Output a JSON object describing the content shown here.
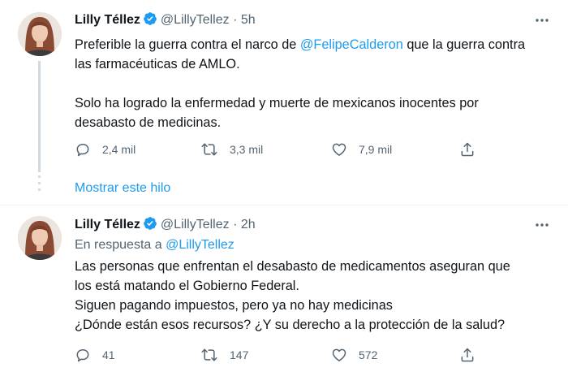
{
  "tweets": [
    {
      "name": "Lilly Téllez",
      "handle": "@LillyTellez",
      "separator": "·",
      "time": "5h",
      "text_lines": [
        [
          "Preferible la guerra contra el narco de ",
          "@FelipeCalderon",
          " que la guerra contra"
        ],
        [
          "las farmacéuticas de AMLO."
        ],
        [
          ""
        ],
        [
          "Solo ha logrado la enfermedad y muerte de mexicanos inocentes por"
        ],
        [
          "desabasto de medicinas."
        ]
      ],
      "replies": "2,4 mil",
      "retweets": "3,3 mil",
      "likes": "7,9 mil"
    },
    {
      "name": "Lilly Téllez",
      "handle": "@LillyTellez",
      "separator": "·",
      "time": "2h",
      "replying_prefix": "En respuesta a ",
      "replying_to": "@LillyTellez",
      "text_lines": [
        "Las personas que enfrentan el desabasto de medicamentos aseguran que",
        "los está matando el Gobierno Federal.",
        "Siguen pagando impuestos, pero ya no hay medicinas",
        "¿Dónde están esos recursos? ¿Y su derecho a la protección de la salud?"
      ],
      "replies": "41",
      "retweets": "147",
      "likes": "572"
    }
  ],
  "show_thread_label": "Mostrar este hilo",
  "icons": {
    "reply": "reply-icon",
    "retweet": "retweet-icon",
    "like": "heart-icon",
    "share": "share-icon",
    "verified": "verified-badge-icon",
    "more": "more-options-icon"
  },
  "colors": {
    "accent": "#1d9bf0",
    "secondary_text": "#536471",
    "thread_line": "#cfd9de"
  }
}
